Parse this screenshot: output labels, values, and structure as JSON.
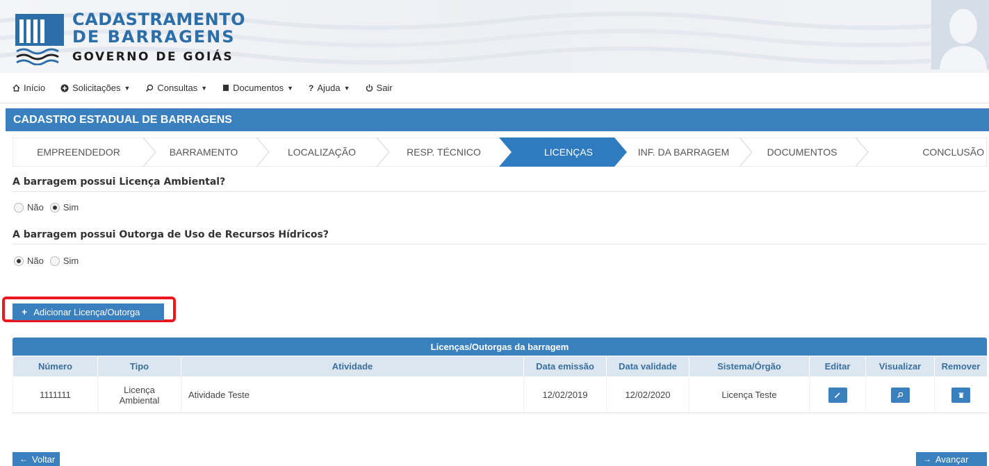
{
  "header": {
    "logo_line1": "CADASTRAMENTO",
    "logo_line2": "DE BARRAGENS",
    "logo_line3": "GOVERNO DE GOIÁS"
  },
  "menu": [
    {
      "label": "Início",
      "icon": "home-icon",
      "dropdown": false
    },
    {
      "label": "Solicitações",
      "icon": "plus-circle-icon",
      "dropdown": true
    },
    {
      "label": "Consultas",
      "icon": "search-icon",
      "dropdown": true
    },
    {
      "label": "Documentos",
      "icon": "book-icon",
      "dropdown": true
    },
    {
      "label": "Ajuda",
      "icon": "question-icon",
      "dropdown": true
    },
    {
      "label": "Sair",
      "icon": "power-icon",
      "dropdown": false
    }
  ],
  "page_title": "CADASTRO ESTADUAL DE BARRAGENS",
  "steps": [
    {
      "label": "EMPREENDEDOR",
      "active": false
    },
    {
      "label": "BARRAMENTO",
      "active": false
    },
    {
      "label": "LOCALIZAÇÃO",
      "active": false
    },
    {
      "label": "RESP. TÉCNICO",
      "active": false
    },
    {
      "label": "LICENÇAS",
      "active": true
    },
    {
      "label": "INF. DA BARRAGEM",
      "active": false
    },
    {
      "label": "DOCUMENTOS",
      "active": false
    },
    {
      "label": "CONCLUSÃO",
      "active": false
    }
  ],
  "questions": {
    "q1": {
      "text": "A barragem possui Licença Ambiental?",
      "options": [
        "Não",
        "Sim"
      ],
      "selected": "Sim"
    },
    "q2": {
      "text": "A barragem possui Outorga de Uso de Recursos Hídricos?",
      "options": [
        "Não",
        "Sim"
      ],
      "selected": "Não"
    }
  },
  "add_button": {
    "label": "Adicionar Licença/Outorga",
    "icon": "plus-icon"
  },
  "table": {
    "caption": "Licenças/Outorgas da barragem",
    "headers": [
      "Número",
      "Tipo",
      "Atividade",
      "Data emissão",
      "Data validade",
      "Sistema/Órgão",
      "Editar",
      "Visualizar",
      "Remover"
    ],
    "rows": [
      {
        "numero": "1111111",
        "tipo_line1": "Licença",
        "tipo_line2": "Ambiental",
        "atividade": "Atividade Teste",
        "data_emissao": "12/02/2019",
        "data_validade": "12/02/2020",
        "sistema_orgao": "Licença Teste"
      }
    ]
  },
  "nav": {
    "back_label": "Voltar",
    "next_label": "Avançar"
  },
  "colors": {
    "primary": "#3a80bf",
    "highlight": "#e8191e",
    "table_header_bg": "#dbe6f1"
  }
}
